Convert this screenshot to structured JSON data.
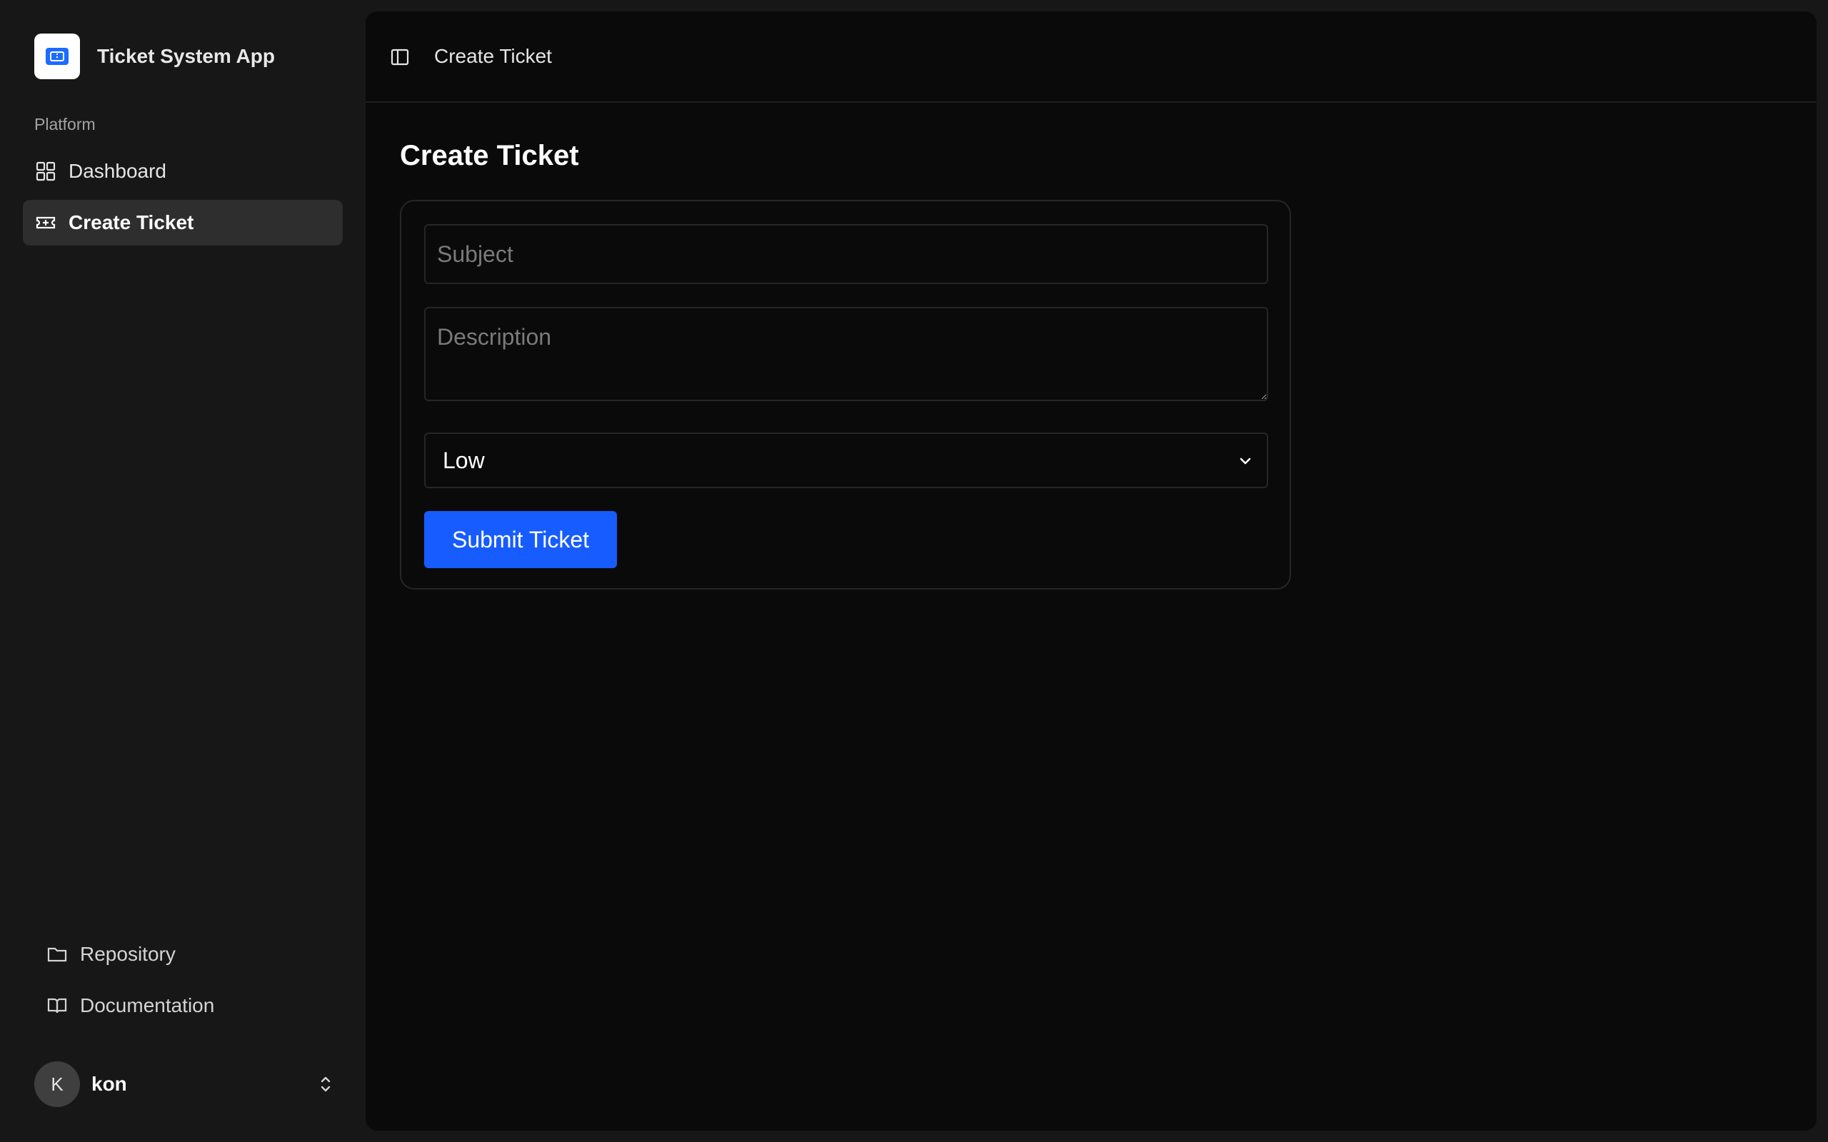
{
  "app": {
    "title": "Ticket System App"
  },
  "sidebar": {
    "group_label": "Platform",
    "items": [
      {
        "label": "Dashboard",
        "icon": "grid-icon"
      },
      {
        "label": "Create Ticket",
        "icon": "ticket-icon",
        "active": true
      }
    ],
    "footer_items": [
      {
        "label": "Repository",
        "icon": "folder-icon"
      },
      {
        "label": "Documentation",
        "icon": "book-icon"
      }
    ],
    "user": {
      "initial": "K",
      "name": "kon"
    }
  },
  "header": {
    "breadcrumb": "Create Ticket"
  },
  "main": {
    "title": "Create Ticket",
    "form": {
      "subject_placeholder": "Subject",
      "subject_value": "",
      "description_placeholder": "Description",
      "description_value": "",
      "priority_selected": "Low",
      "submit_label": "Submit Ticket"
    }
  },
  "colors": {
    "accent": "#175cff",
    "sidebar_bg": "#171717",
    "main_bg": "#0a0a0a",
    "active_item_bg": "#2e2e2e"
  }
}
